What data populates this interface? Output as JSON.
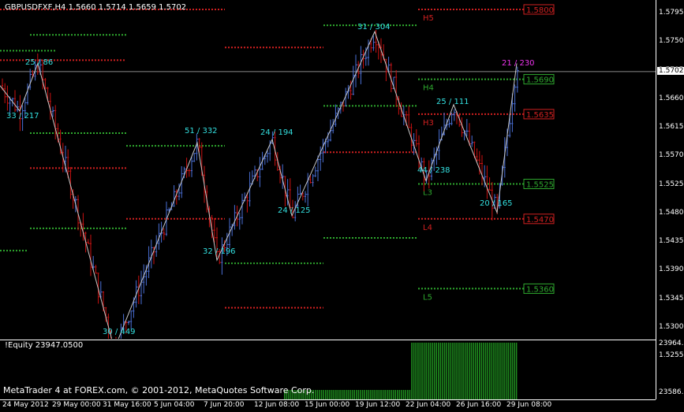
{
  "chart": {
    "symbol_line": "GBPUSDFXF,H4  1.5660 1.5714 1.5659 1.5702",
    "price_labels": [
      "1.5795",
      "1.5750",
      "1.5705",
      "1.5660",
      "1.5615",
      "1.5570",
      "1.5525",
      "1.5480",
      "1.5435",
      "1.5390",
      "1.5345",
      "1.5300",
      "1.5255"
    ],
    "current_price": "1.5702",
    "date_labels": [
      "24 May 2012",
      "29 May 00:00",
      "31 May 16:00",
      "5 Jun 04:00",
      "7 Jun 20:00",
      "12 Jun 08:00",
      "15 Jun 00:00",
      "19 Jun 12:00",
      "22 Jun 04:00",
      "26 Jun 16:00",
      "29 Jun 08:00"
    ],
    "colors": {
      "bull": "#4a6fd6",
      "bear": "#cc1111",
      "zigzag": "#c8c8c8",
      "cyan": "#33e0e0",
      "magenta": "#ee33ee",
      "green": "#2ea82e",
      "red": "#d02020"
    }
  },
  "levels": {
    "H5": {
      "label": "H5",
      "value": "1.5800",
      "color": "red"
    },
    "H4": {
      "label": "H4",
      "value": "1.5690",
      "color": "green"
    },
    "H3": {
      "label": "H3",
      "value": "1.5635",
      "color": "red"
    },
    "L3": {
      "label": "L3",
      "value": "1.5525",
      "color": "green"
    },
    "L4": {
      "label": "L4",
      "value": "1.5470",
      "color": "red"
    },
    "L5": {
      "label": "L5",
      "value": "1.5360",
      "color": "green"
    }
  },
  "zigzag_labels": [
    {
      "text": "25 / 86"
    },
    {
      "text": "33 / 217"
    },
    {
      "text": "30 / 449"
    },
    {
      "text": "51 / 332"
    },
    {
      "text": "32 / 196"
    },
    {
      "text": "24 / 194"
    },
    {
      "text": "24 / 125"
    },
    {
      "text": "31 / 304"
    },
    {
      "text": "44 / 238"
    },
    {
      "text": "25 / 111"
    },
    {
      "text": "20 / 165"
    },
    {
      "text": "21 / 230"
    }
  ],
  "indicator": {
    "title": "!Equity 23947.0500",
    "top_value": "23964.2",
    "bottom_value": "23586.9"
  },
  "footer": {
    "copyright": "MetaTrader 4 at FOREX.com, © 2001-2012, MetaQuotes Software Corp."
  }
}
